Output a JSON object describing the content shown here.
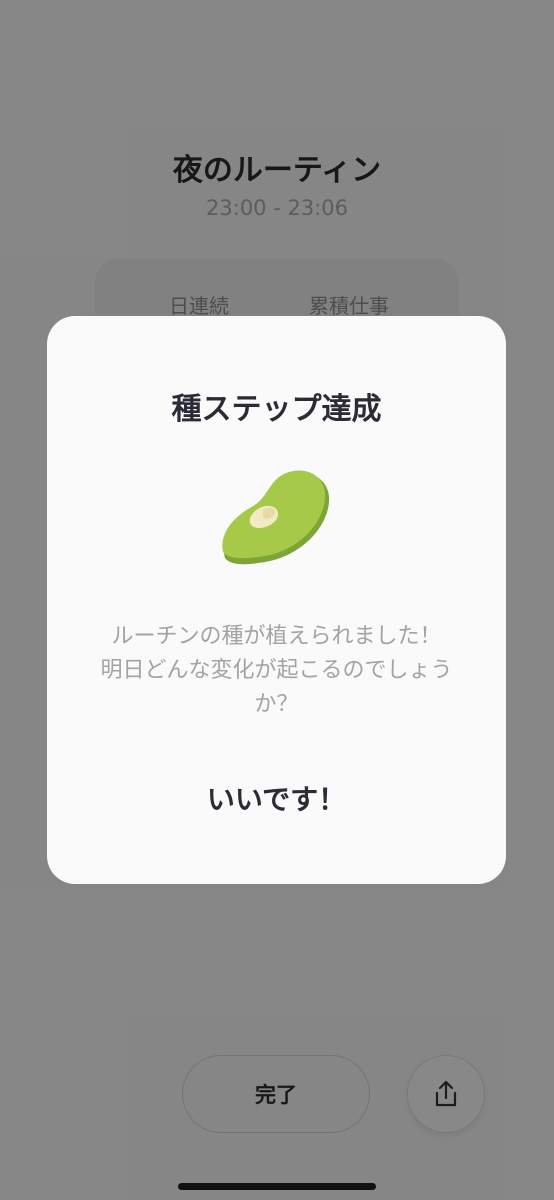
{
  "routine": {
    "title": "夜のルーティン",
    "time_range": "23:00 - 23:06",
    "stats": {
      "streak_label": "日連続",
      "total_label": "累積仕事"
    }
  },
  "footer": {
    "done_label": "完了",
    "share_icon": "share-icon"
  },
  "modal": {
    "title": "種ステップ達成",
    "illustration": "seed-icon",
    "message_lines": [
      "ルーチンの種が植えられました！",
      "明日どんな変化が起こるのでしょう",
      "か？"
    ],
    "confirm_label": "いいです！"
  },
  "colors": {
    "seed_green": "#a6c94a",
    "seed_dark": "#7da535",
    "overlay": "rgba(0,0,0,0.45)"
  }
}
